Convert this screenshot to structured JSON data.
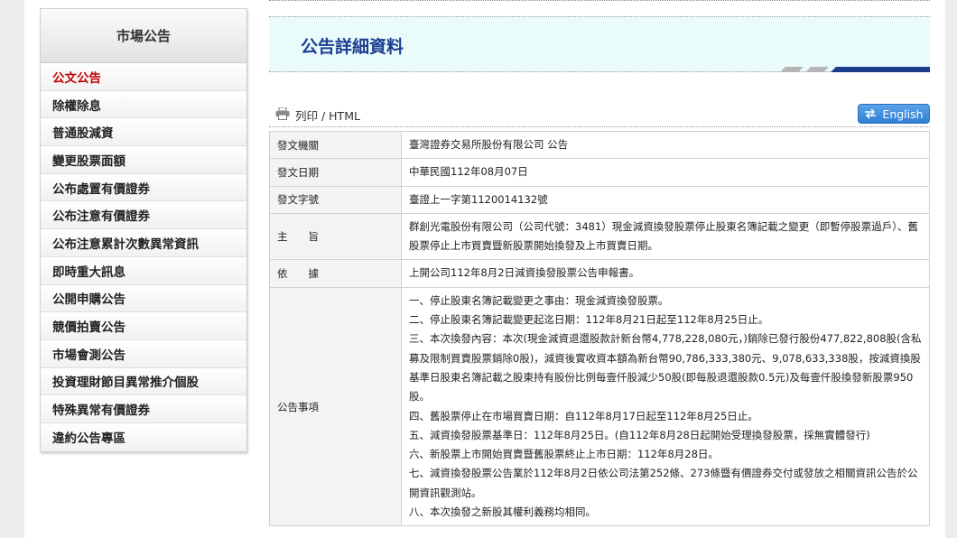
{
  "sidebar": {
    "title": "市場公告",
    "items": [
      {
        "label": "公文公告",
        "active": true
      },
      {
        "label": "除權除息"
      },
      {
        "label": "普通股減資"
      },
      {
        "label": "變更股票面額"
      },
      {
        "label": "公布處置有價證券"
      },
      {
        "label": "公布注意有價證券"
      },
      {
        "label": "公布注意累計次數異常資訊"
      },
      {
        "label": "即時重大訊息"
      },
      {
        "label": "公開申購公告"
      },
      {
        "label": "競價拍賣公告"
      },
      {
        "label": "市場會測公告"
      },
      {
        "label": "投資理財節目異常推介個股"
      },
      {
        "label": "特殊異常有價證券"
      },
      {
        "label": "違約公告專區"
      }
    ]
  },
  "main": {
    "title": "公告詳細資料",
    "print_label": "列印 / HTML",
    "english_label": "English",
    "details": {
      "issuer_label": "發文機關",
      "issuer": "臺灣證券交易所股份有限公司 公告",
      "date_label": "發文日期",
      "date": "中華民國112年08月07日",
      "docno_label": "發文字號",
      "docno": "臺證上一字第1120014132號",
      "subject_label": "主　　旨",
      "subject": "群創光電股份有限公司（公司代號：3481）現金減資換發股票停止股東名簿記載之變更（即暫停股票過戶）、舊股票停止上市買賣暨新股票開始換發及上市買賣日期。",
      "basis_label": "依　　據",
      "basis": "上開公司112年8月2日減資換發股票公告申報書。",
      "matters_label": "公告事項",
      "matters": [
        "一、停止股東名簿記載變更之事由：現金減資換發股票。",
        "二、停止股東名簿記載變更起迄日期：112年8月21日起至112年8月25日止。",
        "三、本次換發內容：本次(現金減資退還股款計新台幣4,778,228,080元，)銷除已發行股份477,822,808股(含私募及限制買賣股票銷除0股)，減資後實收資本額為新台幣90,786,333,380元、9,078,633,338股，按減資換股基準日股東名簿記載之股東持有股份比例每壹仟股減少50股(即每股退還股款0.5元)及每壹仟股換發新股票950股。",
        "四、舊股票停止在市場買賣日期：自112年8月17日起至112年8月25日止。",
        "五、減資換發股票基準日：112年8月25日。(自112年8月28日起開始受理換發股票，採無實體發行)",
        "六、新股票上市開始買賣暨舊股票終止上市日期：112年8月28日。",
        "七、減資換發股票公告業於112年8月2日依公司法第252條、273條暨有價證券交付或發放之相關資訊公告於公開資訊觀測站。",
        "八、本次換發之新股其權利義務均相同。"
      ]
    }
  },
  "colors": {
    "title_blue": "#1b3f8f",
    "active_red": "#c00000",
    "button_blue": "#2f7fd6"
  },
  "icons": {
    "print": "printer-icon",
    "english": "swap-icon"
  }
}
